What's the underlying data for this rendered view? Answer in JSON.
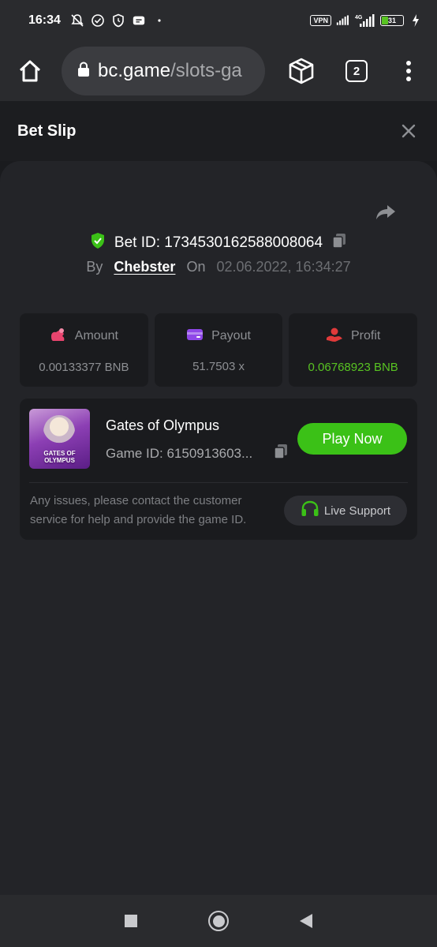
{
  "status_bar": {
    "time": "16:34",
    "vpn": "VPN",
    "network": "4G",
    "battery": "31"
  },
  "browser": {
    "url_domain": "bc.game",
    "url_path": "/slots-ga",
    "tab_count": "2"
  },
  "header": {
    "title": "Bet Slip"
  },
  "bet": {
    "bet_id_label": "Bet ID: 1734530162588008064",
    "by_label": "By",
    "author": "Chebster",
    "on_label": "On",
    "date": "02.06.2022, 16:34:27"
  },
  "stats": [
    {
      "label": "Amount",
      "value": "0.00133377 BNB",
      "icon": "amount-icon",
      "color": "#e8446e"
    },
    {
      "label": "Payout",
      "value": "51.7503 x",
      "icon": "wallet-icon",
      "color": "#8f47e8"
    },
    {
      "label": "Profit",
      "value": "0.06768923 BNB",
      "icon": "profit-icon",
      "color": "#e03a3a"
    }
  ],
  "game": {
    "thumb_text": "GATES OF OLYMPUS",
    "name": "Gates of Olympus",
    "id_label": "Game ID: 6150913603...",
    "play_label": "Play Now",
    "issue_text": "Any issues, please contact the customer service for help and provide the game ID.",
    "support_label": "Live Support"
  },
  "colors": {
    "accent_green": "#3bc117",
    "profit_green": "#58c322",
    "panel": "#232428"
  }
}
